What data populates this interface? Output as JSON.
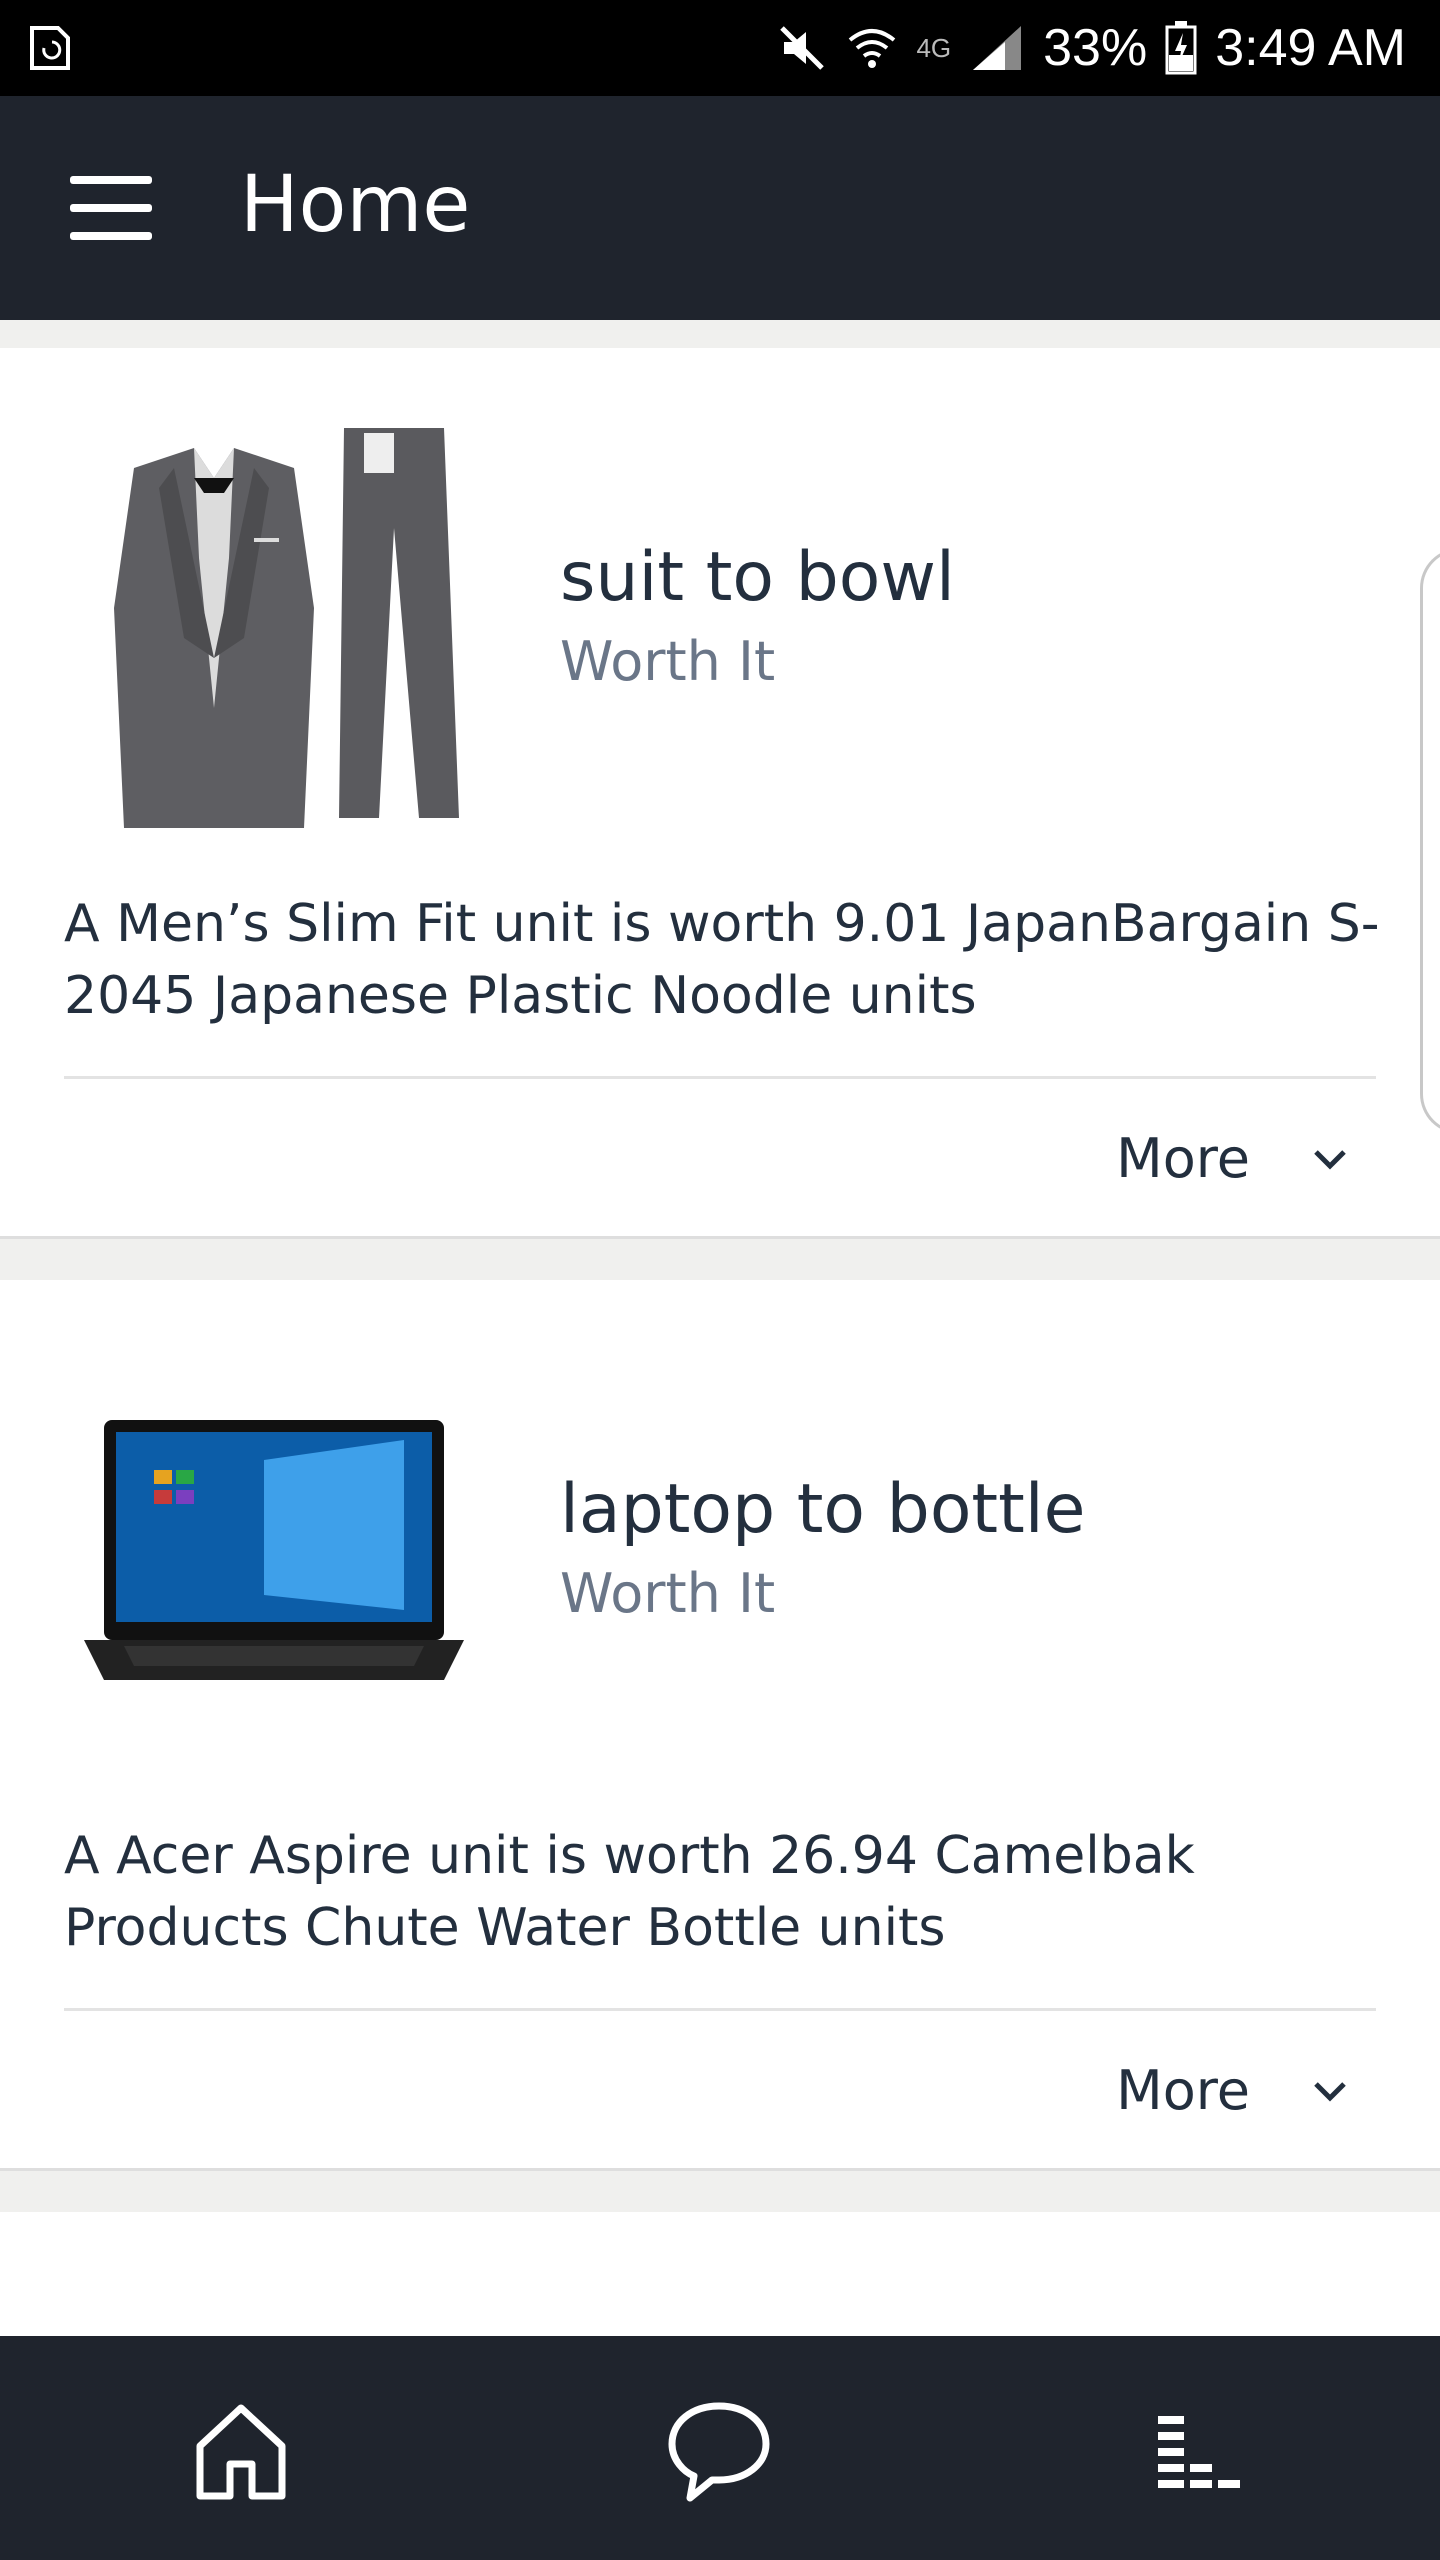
{
  "status_bar": {
    "battery": "33%",
    "time": "3:49 AM",
    "network": "4G",
    "icons": [
      "screen-rotate-icon",
      "mute-icon",
      "wifi-icon",
      "signal-icon",
      "battery-icon"
    ]
  },
  "app_bar": {
    "title": "Home",
    "menu_icon": "hamburger-menu-icon"
  },
  "cards": [
    {
      "title": "suit to bowl",
      "subtitle": "Worth It",
      "description": "A Men’s Slim Fit unit is worth 9.01 JapanBargain S-2045 Japanese Plastic Noodle units",
      "more_label": "More",
      "image": "suit-image"
    },
    {
      "title": "laptop to bottle",
      "subtitle": "Worth It",
      "description": "A Acer Aspire unit is worth 26.94 Camelbak Products Chute Water Bottle units",
      "more_label": "More",
      "image": "laptop-image"
    }
  ],
  "bottom_nav": {
    "items": [
      "home-icon",
      "chat-icon",
      "activity-icon"
    ]
  },
  "colors": {
    "app_bar": "#1f242d",
    "status_bar": "#000000",
    "title_text": "#232f3e",
    "subtitle_text": "#6a7688",
    "page_background": "#f0f0ee"
  }
}
